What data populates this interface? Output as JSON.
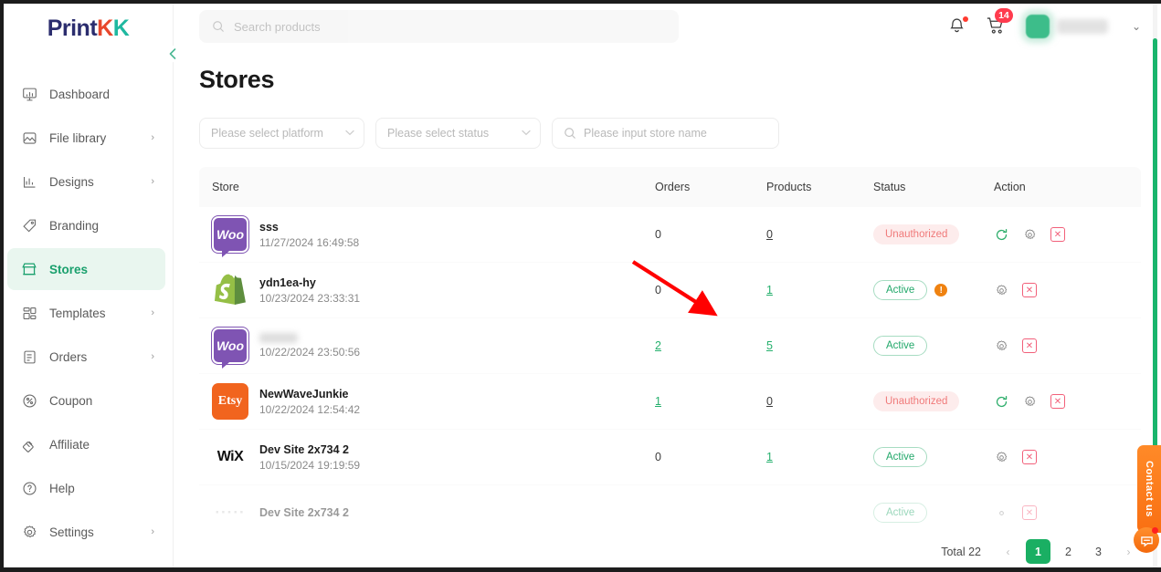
{
  "brand": {
    "name_part1": "Print",
    "name_part2": "K",
    "name_part3": "K"
  },
  "sidebar": {
    "collapse_icon": "chevron-left-icon",
    "items": [
      {
        "label": "Dashboard",
        "icon": "dashboard-icon",
        "chevron": "",
        "active": false
      },
      {
        "label": "File library",
        "icon": "image-icon",
        "chevron": "›",
        "active": false
      },
      {
        "label": "Designs",
        "icon": "designs-icon",
        "chevron": "›",
        "active": false
      },
      {
        "label": "Branding",
        "icon": "tag-icon",
        "chevron": "",
        "active": false
      },
      {
        "label": "Stores",
        "icon": "store-icon",
        "chevron": "",
        "active": true
      },
      {
        "label": "Templates",
        "icon": "templates-icon",
        "chevron": "›",
        "active": false
      },
      {
        "label": "Orders",
        "icon": "orders-icon",
        "chevron": "›",
        "active": false
      },
      {
        "label": "Coupon",
        "icon": "coupon-icon",
        "chevron": "",
        "active": false
      },
      {
        "label": "Affiliate",
        "icon": "affiliate-icon",
        "chevron": "",
        "active": false
      },
      {
        "label": "Help",
        "icon": "help-icon",
        "chevron": "",
        "active": false
      },
      {
        "label": "Settings",
        "icon": "settings-icon",
        "chevron": "›",
        "active": false
      }
    ]
  },
  "topbar": {
    "search_placeholder": "Search products",
    "notification_icon": "bell-icon",
    "notification_has_dot": true,
    "cart_icon": "cart-icon",
    "cart_badge": "14",
    "user_chevron": "⌄"
  },
  "page": {
    "title": "Stores"
  },
  "filters": {
    "platform_placeholder": "Please select platform",
    "status_placeholder": "Please select status",
    "store_name_placeholder": "Please input store name"
  },
  "table": {
    "columns": [
      "Store",
      "Orders",
      "Products",
      "Status",
      "Action"
    ],
    "rows": [
      {
        "platform": "WooCommerce",
        "logo": "woo",
        "name": "sss",
        "name_blurred": false,
        "date": "11/27/2024 16:49:58",
        "orders": "0",
        "orders_link": false,
        "products": "0",
        "products_link": "dark",
        "status": "Unauthorized",
        "status_type": "unauth",
        "warning": false,
        "actions": [
          "refresh",
          "gear",
          "delete"
        ]
      },
      {
        "platform": "Shopify",
        "logo": "shopify",
        "name": "ydn1ea-hy",
        "name_blurred": false,
        "date": "10/23/2024 23:33:31",
        "orders": "0",
        "orders_link": false,
        "products": "1",
        "products_link": "green",
        "status": "Active",
        "status_type": "active",
        "warning": true,
        "warning_text": "!",
        "actions": [
          "gear",
          "delete"
        ]
      },
      {
        "platform": "WooCommerce",
        "logo": "woo",
        "name": "",
        "name_blurred": true,
        "date": "10/22/2024 23:50:56",
        "orders": "2",
        "orders_link": true,
        "products": "5",
        "products_link": "green",
        "status": "Active",
        "status_type": "active",
        "warning": false,
        "actions": [
          "gear",
          "delete"
        ]
      },
      {
        "platform": "Etsy",
        "logo": "etsy",
        "name": "NewWaveJunkie",
        "name_blurred": false,
        "date": "10/22/2024 12:54:42",
        "orders": "1",
        "orders_link": true,
        "products": "0",
        "products_link": "dark",
        "status": "Unauthorized",
        "status_type": "unauth",
        "warning": false,
        "actions": [
          "refresh",
          "gear",
          "delete"
        ]
      },
      {
        "platform": "Wix",
        "logo": "wix",
        "name": "Dev Site 2x734 2",
        "name_blurred": false,
        "date": "10/15/2024 19:19:59",
        "orders": "0",
        "orders_link": false,
        "products": "1",
        "products_link": "green",
        "status": "Active",
        "status_type": "active",
        "warning": false,
        "actions": [
          "gear",
          "delete"
        ]
      },
      {
        "platform": "Wix",
        "logo": "dots",
        "name": "Dev Site 2x734 2",
        "name_blurred": false,
        "date": "",
        "orders": "",
        "orders_link": false,
        "products": "",
        "products_link": "none",
        "status": "Active",
        "status_type": "active",
        "warning": false,
        "actions": [
          "gear",
          "delete"
        ]
      }
    ]
  },
  "pagination": {
    "total_label": "Total 22",
    "prev_icon": "chevron-left-icon",
    "next_icon": "chevron-right-icon",
    "pages": [
      "1",
      "2",
      "3"
    ],
    "active_page": "1"
  },
  "widgets": {
    "contact_tab_label": "Contact us",
    "chat_icon": "chat-bubble-icon"
  },
  "colors": {
    "brand_green": "#1aa06d",
    "accent_orange": "#f96f12",
    "danger_red": "#f2607a",
    "active_badge": "#22a86a",
    "unauth_badge": "#f07a7a",
    "annotation_arrow": "#ff0000"
  }
}
